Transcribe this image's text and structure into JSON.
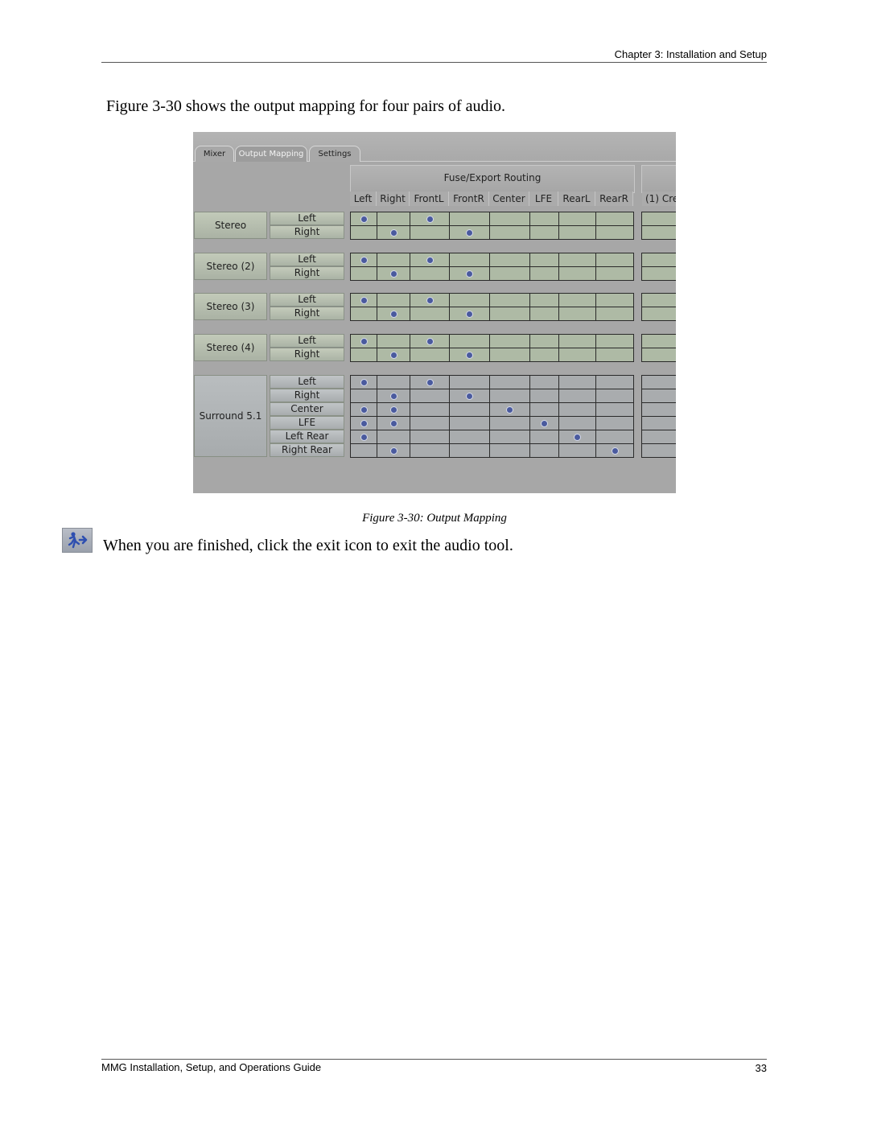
{
  "header": {
    "chapter": "Chapter 3: Installation and Setup"
  },
  "intro_text": "Figure 3-30 shows the output mapping for four pairs of audio.",
  "figure": {
    "tabs": [
      {
        "label": "Mixer",
        "active": false
      },
      {
        "label": "Output Mapping",
        "active": true
      },
      {
        "label": "Settings",
        "active": false
      }
    ],
    "group_header": "Fuse/Export Routing",
    "columns": [
      "Left",
      "Right",
      "FrontL",
      "FrontR",
      "Center",
      "LFE",
      "RearL",
      "RearR"
    ],
    "extra_column": "(1) Cre",
    "groups": [
      {
        "label": "Stereo",
        "type": "stereo",
        "channels": [
          {
            "label": "Left",
            "routes": [
              0,
              2
            ]
          },
          {
            "label": "Right",
            "routes": [
              1,
              3
            ]
          }
        ]
      },
      {
        "label": "Stereo (2)",
        "type": "stereo",
        "channels": [
          {
            "label": "Left",
            "routes": [
              0,
              2
            ]
          },
          {
            "label": "Right",
            "routes": [
              1,
              3
            ]
          }
        ]
      },
      {
        "label": "Stereo (3)",
        "type": "stereo",
        "channels": [
          {
            "label": "Left",
            "routes": [
              0,
              2
            ]
          },
          {
            "label": "Right",
            "routes": [
              1,
              3
            ]
          }
        ]
      },
      {
        "label": "Stereo (4)",
        "type": "stereo",
        "channels": [
          {
            "label": "Left",
            "routes": [
              0,
              2
            ]
          },
          {
            "label": "Right",
            "routes": [
              1,
              3
            ]
          }
        ]
      },
      {
        "label": "Surround 5.1",
        "type": "surround",
        "channels": [
          {
            "label": "Left",
            "routes": [
              0,
              2
            ]
          },
          {
            "label": "Right",
            "routes": [
              1,
              3
            ]
          },
          {
            "label": "Center",
            "routes": [
              0,
              1,
              4
            ]
          },
          {
            "label": "LFE",
            "routes": [
              0,
              1,
              5
            ]
          },
          {
            "label": "Left Rear",
            "routes": [
              0,
              6
            ]
          },
          {
            "label": "Right Rear",
            "routes": [
              1,
              7
            ]
          }
        ]
      }
    ]
  },
  "caption": "Figure 3-30: Output Mapping",
  "exit_instruction": "When you are finished, click the exit icon to exit the audio tool.",
  "exit_icon": "exit-running-man-icon",
  "footer": {
    "title": "MMG Installation, Setup, and Operations Guide",
    "page": "33"
  }
}
